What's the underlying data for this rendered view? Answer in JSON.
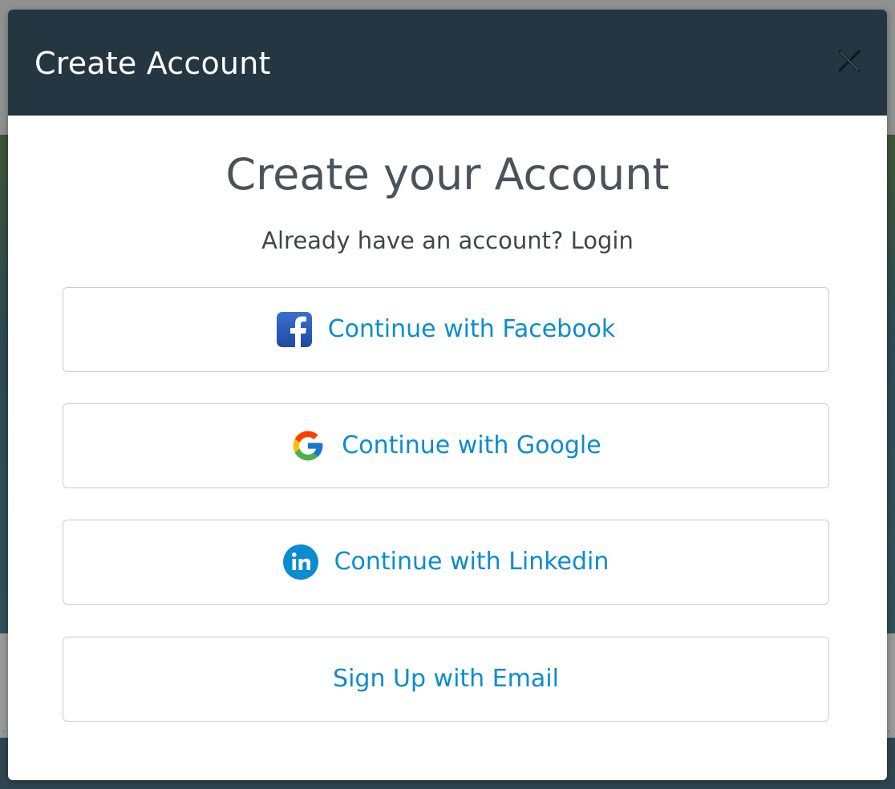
{
  "modal": {
    "title": "Create Account",
    "close_label": "×"
  },
  "body": {
    "heading": "Create your Account",
    "login_prompt": "Already have an account? Login"
  },
  "buttons": [
    {
      "label": "Continue with Facebook",
      "icon": "facebook-icon"
    },
    {
      "label": "Continue with Google",
      "icon": "google-icon"
    },
    {
      "label": "Continue with Linkedin",
      "icon": "linkedin-icon"
    },
    {
      "label": "Sign Up with Email",
      "icon": null
    }
  ],
  "colors": {
    "header_bg": "#233642",
    "accent": "#0b8ccf",
    "heading_text": "#4a535b",
    "facebook": "#2f5eb8",
    "linkedin": "#0b8ccf"
  }
}
